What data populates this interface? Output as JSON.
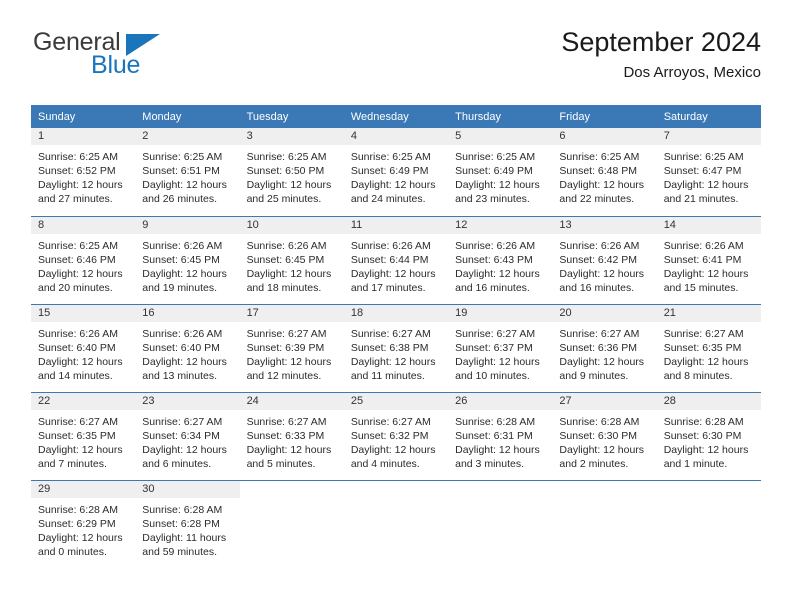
{
  "brand": {
    "name_part1": "General",
    "name_part2": "Blue",
    "logo_icon": "triangle-flag-icon",
    "accent_color": "#1b75bb"
  },
  "header": {
    "title": "September 2024",
    "subtitle": "Dos Arroyos, Mexico"
  },
  "theme": {
    "header_bg": "#3b78b6",
    "daynum_bg": "#efefef",
    "text_color": "#2b2b2b"
  },
  "columns": [
    "Sunday",
    "Monday",
    "Tuesday",
    "Wednesday",
    "Thursday",
    "Friday",
    "Saturday"
  ],
  "weeks": [
    [
      {
        "day": "1",
        "sunrise": "Sunrise: 6:25 AM",
        "sunset": "Sunset: 6:52 PM",
        "daylight_line1": "Daylight: 12 hours",
        "daylight_line2": "and 27 minutes."
      },
      {
        "day": "2",
        "sunrise": "Sunrise: 6:25 AM",
        "sunset": "Sunset: 6:51 PM",
        "daylight_line1": "Daylight: 12 hours",
        "daylight_line2": "and 26 minutes."
      },
      {
        "day": "3",
        "sunrise": "Sunrise: 6:25 AM",
        "sunset": "Sunset: 6:50 PM",
        "daylight_line1": "Daylight: 12 hours",
        "daylight_line2": "and 25 minutes."
      },
      {
        "day": "4",
        "sunrise": "Sunrise: 6:25 AM",
        "sunset": "Sunset: 6:49 PM",
        "daylight_line1": "Daylight: 12 hours",
        "daylight_line2": "and 24 minutes."
      },
      {
        "day": "5",
        "sunrise": "Sunrise: 6:25 AM",
        "sunset": "Sunset: 6:49 PM",
        "daylight_line1": "Daylight: 12 hours",
        "daylight_line2": "and 23 minutes."
      },
      {
        "day": "6",
        "sunrise": "Sunrise: 6:25 AM",
        "sunset": "Sunset: 6:48 PM",
        "daylight_line1": "Daylight: 12 hours",
        "daylight_line2": "and 22 minutes."
      },
      {
        "day": "7",
        "sunrise": "Sunrise: 6:25 AM",
        "sunset": "Sunset: 6:47 PM",
        "daylight_line1": "Daylight: 12 hours",
        "daylight_line2": "and 21 minutes."
      }
    ],
    [
      {
        "day": "8",
        "sunrise": "Sunrise: 6:25 AM",
        "sunset": "Sunset: 6:46 PM",
        "daylight_line1": "Daylight: 12 hours",
        "daylight_line2": "and 20 minutes."
      },
      {
        "day": "9",
        "sunrise": "Sunrise: 6:26 AM",
        "sunset": "Sunset: 6:45 PM",
        "daylight_line1": "Daylight: 12 hours",
        "daylight_line2": "and 19 minutes."
      },
      {
        "day": "10",
        "sunrise": "Sunrise: 6:26 AM",
        "sunset": "Sunset: 6:45 PM",
        "daylight_line1": "Daylight: 12 hours",
        "daylight_line2": "and 18 minutes."
      },
      {
        "day": "11",
        "sunrise": "Sunrise: 6:26 AM",
        "sunset": "Sunset: 6:44 PM",
        "daylight_line1": "Daylight: 12 hours",
        "daylight_line2": "and 17 minutes."
      },
      {
        "day": "12",
        "sunrise": "Sunrise: 6:26 AM",
        "sunset": "Sunset: 6:43 PM",
        "daylight_line1": "Daylight: 12 hours",
        "daylight_line2": "and 16 minutes."
      },
      {
        "day": "13",
        "sunrise": "Sunrise: 6:26 AM",
        "sunset": "Sunset: 6:42 PM",
        "daylight_line1": "Daylight: 12 hours",
        "daylight_line2": "and 16 minutes."
      },
      {
        "day": "14",
        "sunrise": "Sunrise: 6:26 AM",
        "sunset": "Sunset: 6:41 PM",
        "daylight_line1": "Daylight: 12 hours",
        "daylight_line2": "and 15 minutes."
      }
    ],
    [
      {
        "day": "15",
        "sunrise": "Sunrise: 6:26 AM",
        "sunset": "Sunset: 6:40 PM",
        "daylight_line1": "Daylight: 12 hours",
        "daylight_line2": "and 14 minutes."
      },
      {
        "day": "16",
        "sunrise": "Sunrise: 6:26 AM",
        "sunset": "Sunset: 6:40 PM",
        "daylight_line1": "Daylight: 12 hours",
        "daylight_line2": "and 13 minutes."
      },
      {
        "day": "17",
        "sunrise": "Sunrise: 6:27 AM",
        "sunset": "Sunset: 6:39 PM",
        "daylight_line1": "Daylight: 12 hours",
        "daylight_line2": "and 12 minutes."
      },
      {
        "day": "18",
        "sunrise": "Sunrise: 6:27 AM",
        "sunset": "Sunset: 6:38 PM",
        "daylight_line1": "Daylight: 12 hours",
        "daylight_line2": "and 11 minutes."
      },
      {
        "day": "19",
        "sunrise": "Sunrise: 6:27 AM",
        "sunset": "Sunset: 6:37 PM",
        "daylight_line1": "Daylight: 12 hours",
        "daylight_line2": "and 10 minutes."
      },
      {
        "day": "20",
        "sunrise": "Sunrise: 6:27 AM",
        "sunset": "Sunset: 6:36 PM",
        "daylight_line1": "Daylight: 12 hours",
        "daylight_line2": "and 9 minutes."
      },
      {
        "day": "21",
        "sunrise": "Sunrise: 6:27 AM",
        "sunset": "Sunset: 6:35 PM",
        "daylight_line1": "Daylight: 12 hours",
        "daylight_line2": "and 8 minutes."
      }
    ],
    [
      {
        "day": "22",
        "sunrise": "Sunrise: 6:27 AM",
        "sunset": "Sunset: 6:35 PM",
        "daylight_line1": "Daylight: 12 hours",
        "daylight_line2": "and 7 minutes."
      },
      {
        "day": "23",
        "sunrise": "Sunrise: 6:27 AM",
        "sunset": "Sunset: 6:34 PM",
        "daylight_line1": "Daylight: 12 hours",
        "daylight_line2": "and 6 minutes."
      },
      {
        "day": "24",
        "sunrise": "Sunrise: 6:27 AM",
        "sunset": "Sunset: 6:33 PM",
        "daylight_line1": "Daylight: 12 hours",
        "daylight_line2": "and 5 minutes."
      },
      {
        "day": "25",
        "sunrise": "Sunrise: 6:27 AM",
        "sunset": "Sunset: 6:32 PM",
        "daylight_line1": "Daylight: 12 hours",
        "daylight_line2": "and 4 minutes."
      },
      {
        "day": "26",
        "sunrise": "Sunrise: 6:28 AM",
        "sunset": "Sunset: 6:31 PM",
        "daylight_line1": "Daylight: 12 hours",
        "daylight_line2": "and 3 minutes."
      },
      {
        "day": "27",
        "sunrise": "Sunrise: 6:28 AM",
        "sunset": "Sunset: 6:30 PM",
        "daylight_line1": "Daylight: 12 hours",
        "daylight_line2": "and 2 minutes."
      },
      {
        "day": "28",
        "sunrise": "Sunrise: 6:28 AM",
        "sunset": "Sunset: 6:30 PM",
        "daylight_line1": "Daylight: 12 hours",
        "daylight_line2": "and 1 minute."
      }
    ],
    [
      {
        "day": "29",
        "sunrise": "Sunrise: 6:28 AM",
        "sunset": "Sunset: 6:29 PM",
        "daylight_line1": "Daylight: 12 hours",
        "daylight_line2": "and 0 minutes."
      },
      {
        "day": "30",
        "sunrise": "Sunrise: 6:28 AM",
        "sunset": "Sunset: 6:28 PM",
        "daylight_line1": "Daylight: 11 hours",
        "daylight_line2": "and 59 minutes."
      },
      {
        "day": "",
        "sunrise": "",
        "sunset": "",
        "daylight_line1": "",
        "daylight_line2": ""
      },
      {
        "day": "",
        "sunrise": "",
        "sunset": "",
        "daylight_line1": "",
        "daylight_line2": ""
      },
      {
        "day": "",
        "sunrise": "",
        "sunset": "",
        "daylight_line1": "",
        "daylight_line2": ""
      },
      {
        "day": "",
        "sunrise": "",
        "sunset": "",
        "daylight_line1": "",
        "daylight_line2": ""
      },
      {
        "day": "",
        "sunrise": "",
        "sunset": "",
        "daylight_line1": "",
        "daylight_line2": ""
      }
    ]
  ]
}
